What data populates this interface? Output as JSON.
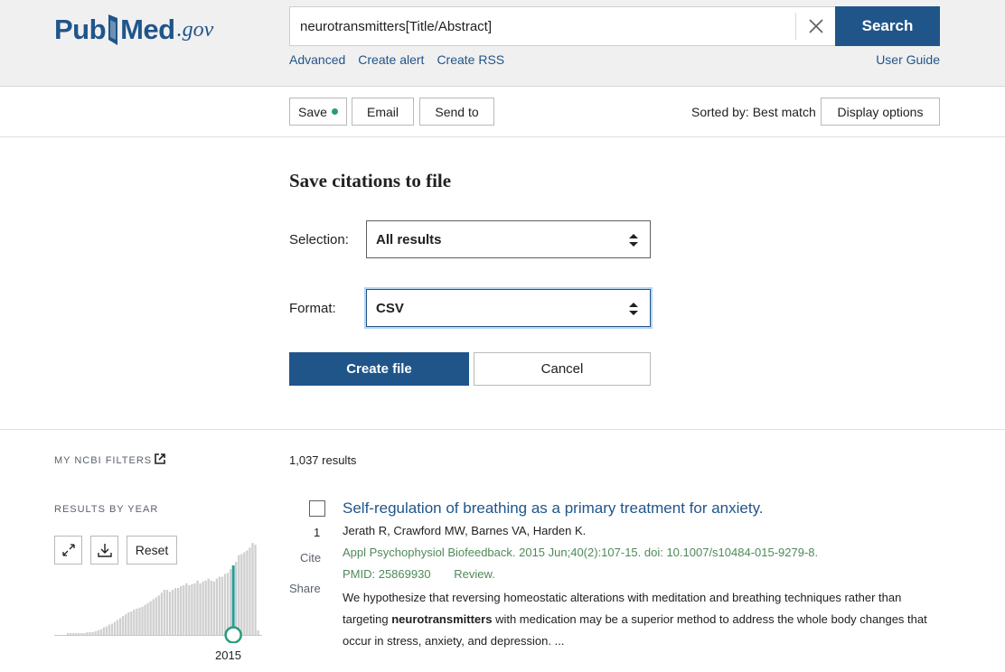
{
  "colors": {
    "brand": "#20558a",
    "accent_green": "#2a9b7b",
    "journal_green": "#4f8a58"
  },
  "logo": {
    "pub": "Pub",
    "med": "Med",
    "gov": ".gov"
  },
  "search": {
    "value": "neurotransmitters[Title/Abstract]",
    "button": "Search",
    "clear_icon": "close-x"
  },
  "links": {
    "advanced": "Advanced",
    "create_alert": "Create alert",
    "create_rss": "Create RSS",
    "user_guide": "User Guide"
  },
  "toolbar": {
    "save": "Save",
    "email": "Email",
    "send_to": "Send to",
    "sorted_by": "Sorted by: Best match",
    "display_options": "Display options"
  },
  "save_panel": {
    "title": "Save citations to file",
    "selection_label": "Selection:",
    "selection_value": "All results",
    "format_label": "Format:",
    "format_value": "CSV",
    "create_button": "Create file",
    "cancel_button": "Cancel"
  },
  "sidebar": {
    "filters_heading": "MY NCBI FILTERS",
    "year_heading": "RESULTS BY YEAR",
    "reset": "Reset",
    "selected_year": "2015",
    "histogram_relative": [
      0.02,
      0.02,
      0.02,
      0.02,
      0.02,
      0.02,
      0.02,
      0.03,
      0.03,
      0.03,
      0.04,
      0.05,
      0.06,
      0.08,
      0.09,
      0.11,
      0.12,
      0.14,
      0.16,
      0.18,
      0.2,
      0.22,
      0.24,
      0.25,
      0.27,
      0.28,
      0.29,
      0.3,
      0.32,
      0.34,
      0.36,
      0.38,
      0.4,
      0.42,
      0.45,
      0.48,
      0.48,
      0.46,
      0.48,
      0.5,
      0.5,
      0.52,
      0.53,
      0.55,
      0.53,
      0.54,
      0.55,
      0.58,
      0.55,
      0.57,
      0.58,
      0.6,
      0.58,
      0.57,
      0.6,
      0.62,
      0.62,
      0.65,
      0.66,
      0.7,
      0.74,
      0.78,
      0.85,
      0.86,
      0.88,
      0.9,
      0.93,
      0.98,
      0.96,
      0.05
    ]
  },
  "results": {
    "count": "1,037 results",
    "items": [
      {
        "number": "1",
        "title": "Self-regulation of breathing as a primary treatment for anxiety.",
        "authors": "Jerath R, Crawford MW, Barnes VA, Harden K.",
        "journal": "Appl Psychophysiol Biofeedback. 2015 Jun;40(2):107-15. doi: 10.1007/s10484-015-9279-8.",
        "pmid": "PMID: 25869930",
        "type": "Review.",
        "cite": "Cite",
        "share": "Share",
        "snippet_1": "We hypothesize that reversing homeostatic alterations with meditation and breathing techniques rather than targeting ",
        "snippet_bold": "neurotransmitters",
        "snippet_2": " with medication may be a superior method to address the whole body changes that occur in stress, anxiety, and depression. ..."
      }
    ]
  }
}
